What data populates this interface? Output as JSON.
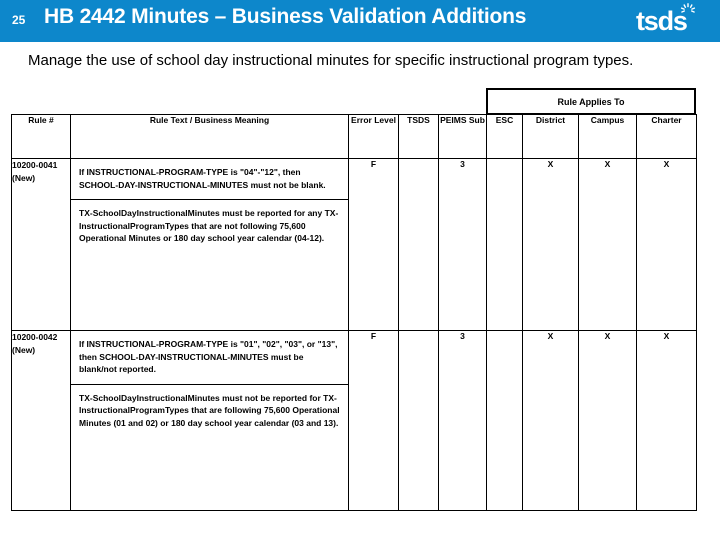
{
  "header": {
    "slide_number": "25",
    "title": "HB 2442 Minutes – Business Validation Additions",
    "brand": "tsds",
    "brand_icon": "starburst-icon",
    "band_color": "#0d87cb"
  },
  "subtitle": "Manage the use of school day instructional minutes for specific instructional program types.",
  "table": {
    "group_header": {
      "label": "Rule Applies To",
      "spans": [
        "ESC",
        "District",
        "Campus",
        "Charter"
      ]
    },
    "columns": [
      "Rule #",
      "Rule Text / Business Meaning",
      "Error Level",
      "TSDS",
      "PEIMS Sub",
      "ESC",
      "District",
      "Campus",
      "Charter"
    ],
    "rows": [
      {
        "rule_number": "10200-0041 (New)",
        "rule_text": "If INSTRUCTIONAL-PROGRAM-TYPE is \"04\"-\"12\", then SCHOOL-DAY-INSTRUCTIONAL-MINUTES must not be blank.",
        "business_meaning": "TX-SchoolDayInstructionalMinutes must be reported for any TX-InstructionalProgramTypes that are not following 75,600 Operational Minutes or 180 day school year calendar (04-12).",
        "error_level": "F",
        "tsds": "",
        "peims_sub": "3",
        "esc": "",
        "district": "X",
        "campus": "X",
        "charter": "X"
      },
      {
        "rule_number": "10200-0042 (New)",
        "rule_text": "If INSTRUCTIONAL-PROGRAM-TYPE is \"01\", \"02\", \"03\", or \"13\", then SCHOOL-DAY-INSTRUCTIONAL-MINUTES must be blank/not reported.",
        "business_meaning": "TX-SchoolDayInstructionalMinutes must not be reported for TX-InstructionalProgramTypes that are following 75,600 Operational Minutes (01 and 02) or 180 day school year calendar (03 and 13).",
        "error_level": "F",
        "tsds": "",
        "peims_sub": "3",
        "esc": "",
        "district": "X",
        "campus": "X",
        "charter": "X"
      }
    ]
  }
}
